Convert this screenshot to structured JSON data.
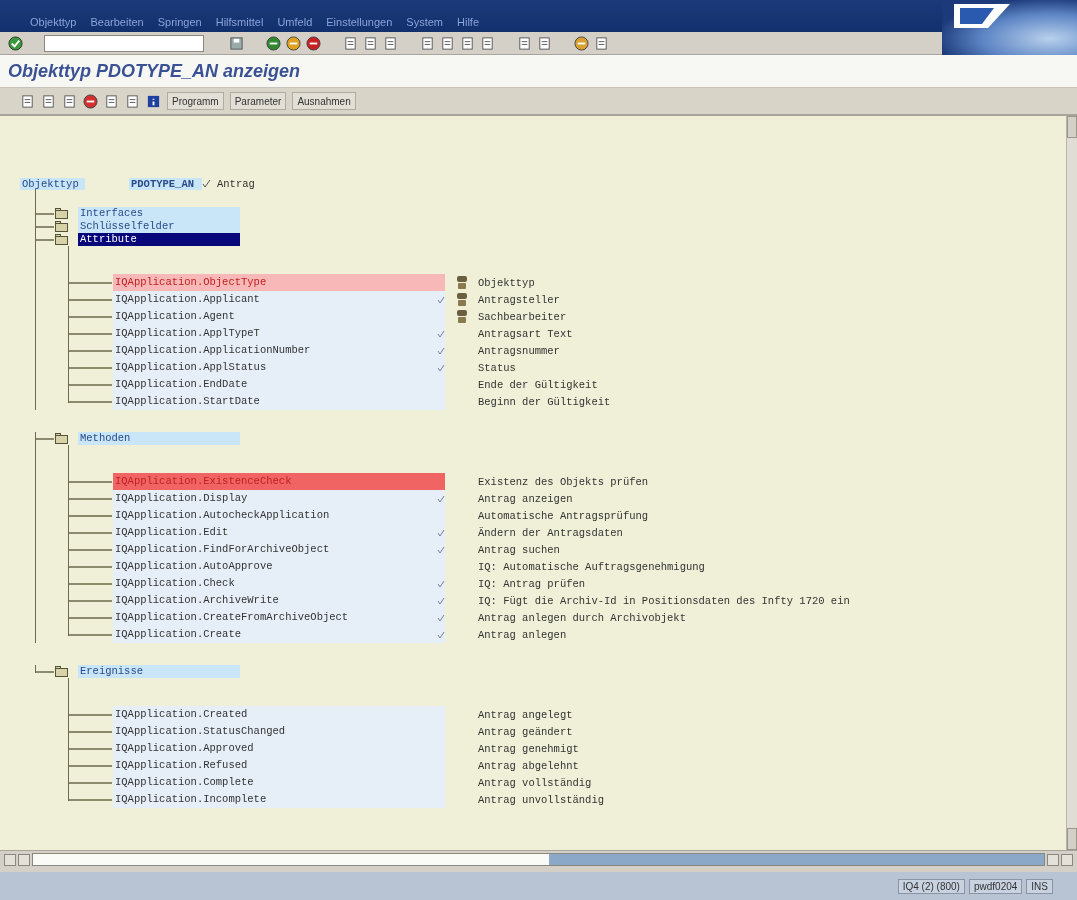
{
  "menu": [
    "Objekttyp",
    "Bearbeiten",
    "Springen",
    "Hilfsmittel",
    "Umfeld",
    "Einstellungen",
    "System",
    "Hilfe"
  ],
  "title": "Objekttyp PDOTYPE_AN anzeigen",
  "app_buttons": [
    "Programm",
    "Parameter",
    "Ausnahmen"
  ],
  "header": {
    "label": "Objekttyp",
    "object": "PDOTYPE_AN",
    "text": "Antrag"
  },
  "tree": {
    "groups": [
      {
        "label": "Interfaces",
        "selected": false
      },
      {
        "label": "Schlüsselfelder",
        "selected": false
      },
      {
        "label": "Attribute",
        "selected": true,
        "rows": [
          {
            "name": "IQApplication.ObjectType",
            "description": "Objekttyp",
            "checked": false,
            "color": "#f8b8b8",
            "flagged": true,
            "linked": true
          },
          {
            "name": "IQApplication.Applicant",
            "description": "Antragsteller",
            "checked": true,
            "color": "#e6eef8",
            "flagged": false,
            "linked": true
          },
          {
            "name": "IQApplication.Agent",
            "description": "Sachbearbeiter",
            "checked": false,
            "color": "#e6eef8",
            "flagged": false,
            "linked": true
          },
          {
            "name": "IQApplication.ApplTypeT",
            "description": "Antragsart Text",
            "checked": true,
            "color": "#e6eef8",
            "flagged": false,
            "linked": false
          },
          {
            "name": "IQApplication.ApplicationNumber",
            "description": "Antragsnummer",
            "checked": true,
            "color": "#e6eef8",
            "flagged": false,
            "linked": false
          },
          {
            "name": "IQApplication.ApplStatus",
            "description": "Status",
            "checked": true,
            "color": "#e6eef8",
            "flagged": false,
            "linked": false
          },
          {
            "name": "IQApplication.EndDate",
            "description": "Ende der Gültigkeit",
            "checked": false,
            "color": "#e6eef8",
            "flagged": false,
            "linked": false
          },
          {
            "name": "IQApplication.StartDate",
            "description": "Beginn der Gültigkeit",
            "checked": false,
            "color": "#e6eef8",
            "flagged": false,
            "linked": false
          }
        ]
      },
      {
        "label": "Methoden",
        "selected": false,
        "rows": [
          {
            "name": "IQApplication.ExistenceCheck",
            "description": "Existenz des Objekts prüfen",
            "checked": false,
            "color": "#f06464",
            "flagged": true,
            "linked": false
          },
          {
            "name": "IQApplication.Display",
            "description": "Antrag anzeigen",
            "checked": true,
            "color": "#e6eef8",
            "flagged": false,
            "linked": false
          },
          {
            "name": "IQApplication.AutocheckApplication",
            "description": "Automatische Antragsprüfung",
            "checked": false,
            "color": "#e6eef8",
            "flagged": false,
            "linked": false
          },
          {
            "name": "IQApplication.Edit",
            "description": "Ändern der Antragsdaten",
            "checked": true,
            "color": "#e6eef8",
            "flagged": false,
            "linked": false
          },
          {
            "name": "IQApplication.FindForArchiveObject",
            "description": "Antrag suchen",
            "checked": true,
            "color": "#e6eef8",
            "flagged": false,
            "linked": false
          },
          {
            "name": "IQApplication.AutoApprove",
            "description": "IQ: Automatische Auftragsgenehmigung",
            "checked": false,
            "color": "#e6eef8",
            "flagged": false,
            "linked": false
          },
          {
            "name": "IQApplication.Check",
            "description": "IQ: Antrag prüfen",
            "checked": true,
            "color": "#e6eef8",
            "flagged": false,
            "linked": false
          },
          {
            "name": "IQApplication.ArchiveWrite",
            "description": "IQ: Fügt die Archiv-Id in Positionsdaten des Infty 1720 ein",
            "checked": true,
            "color": "#e6eef8",
            "flagged": false,
            "linked": false
          },
          {
            "name": "IQApplication.CreateFromArchiveObject",
            "description": "Antrag anlegen durch Archivobjekt",
            "checked": true,
            "color": "#e6eef8",
            "flagged": false,
            "linked": false
          },
          {
            "name": "IQApplication.Create",
            "description": "Antrag anlegen",
            "checked": true,
            "color": "#e6eef8",
            "flagged": false,
            "linked": false
          }
        ]
      },
      {
        "label": "Ereignisse",
        "selected": false,
        "rows": [
          {
            "name": "IQApplication.Created",
            "description": "Antrag angelegt",
            "color": "#e6eef8",
            "flagged": false
          },
          {
            "name": "IQApplication.StatusChanged",
            "description": "Antrag geändert",
            "color": "#e6eef8",
            "flagged": false
          },
          {
            "name": "IQApplication.Approved",
            "description": "Antrag genehmigt",
            "color": "#e6eef8",
            "flagged": false
          },
          {
            "name": "IQApplication.Refused",
            "description": "Antrag abgelehnt",
            "color": "#e6eef8",
            "flagged": false
          },
          {
            "name": "IQApplication.Complete",
            "description": "Antrag vollständig",
            "color": "#e6eef8",
            "flagged": false
          },
          {
            "name": "IQApplication.Incomplete",
            "description": "Antrag unvollständig",
            "color": "#e6eef8",
            "flagged": false
          }
        ]
      }
    ]
  },
  "status_bar": {
    "system": "IQ4 (2) (800)",
    "server": "pwdf0204",
    "mode": "INS"
  }
}
